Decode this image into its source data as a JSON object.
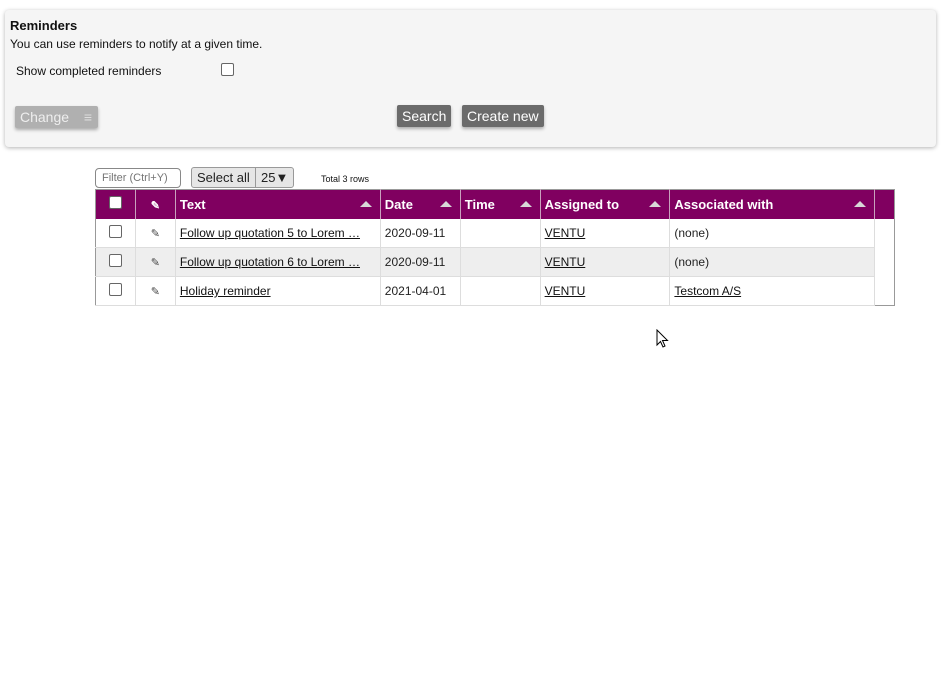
{
  "panel": {
    "title": "Reminders",
    "description": "You can use reminders to notify at a given time.",
    "show_completed_label": "Show completed reminders",
    "show_completed_checked": false,
    "change_label": "Change",
    "search_label": "Search",
    "create_label": "Create new"
  },
  "toolbar": {
    "filter_placeholder": "Filter (Ctrl+Y)",
    "select_all_label": "Select all",
    "page_size": "25▼",
    "total": "Total 3 rows"
  },
  "table": {
    "columns": [
      "Text",
      "Date",
      "Time",
      "Assigned to",
      "Associated with"
    ],
    "rows": [
      {
        "text": "Follow up quotation 5 to Lorem …",
        "date": "2020-09-11",
        "time": "",
        "assigned": "VENTU",
        "associated": "(none)",
        "associated_link": false
      },
      {
        "text": "Follow up quotation 6 to Lorem …",
        "date": "2020-09-11",
        "time": "",
        "assigned": "VENTU",
        "associated": "(none)",
        "associated_link": false
      },
      {
        "text": "Holiday reminder",
        "date": "2021-04-01",
        "time": "",
        "assigned": "VENTU",
        "associated": "Testcom A/S",
        "associated_link": true
      }
    ]
  },
  "colors": {
    "header": "#800060"
  }
}
